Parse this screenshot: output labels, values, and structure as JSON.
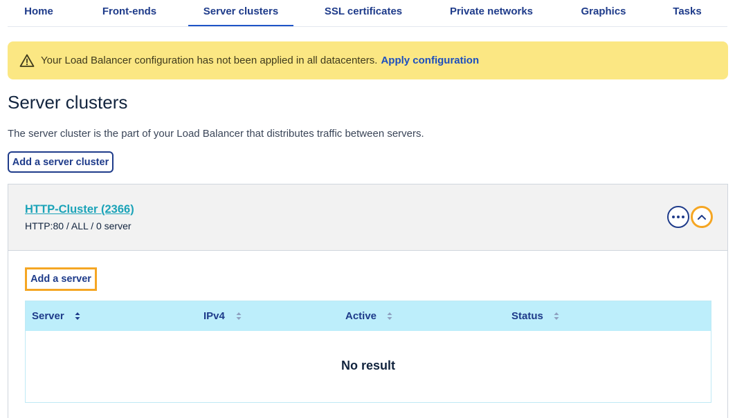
{
  "tabs": [
    {
      "label": "Home"
    },
    {
      "label": "Front-ends"
    },
    {
      "label": "Server clusters"
    },
    {
      "label": "SSL certificates"
    },
    {
      "label": "Private networks"
    },
    {
      "label": "Graphics"
    },
    {
      "label": "Tasks"
    }
  ],
  "active_tab": "Server clusters",
  "alert": {
    "icon": "warning-triangle-icon",
    "text": "Your Load Balancer configuration has not been applied in all datacenters.",
    "link": "Apply configuration"
  },
  "page": {
    "title": "Server clusters",
    "description": "The server cluster is the part of your Load Balancer that distributes traffic between servers.",
    "add_cluster_label": "Add a server cluster"
  },
  "cluster": {
    "name": "HTTP-Cluster (2366)",
    "meta": "HTTP:80 / ALL / 0 server",
    "add_server_label": "Add a server",
    "table": {
      "columns": [
        {
          "label": "Server",
          "sort_state": "active"
        },
        {
          "label": "IPv4",
          "sort_state": "inactive"
        },
        {
          "label": "Active",
          "sort_state": "inactive"
        },
        {
          "label": "Status",
          "sort_state": "inactive"
        }
      ],
      "empty_message": "No result"
    }
  },
  "colors": {
    "primary": "#1e3b8a",
    "link": "#1c4fbe",
    "cluster_link": "#1ba3b8",
    "alert_bg": "#fbe783",
    "highlight": "#f5a623",
    "table_header_bg": "#bdeefb"
  }
}
